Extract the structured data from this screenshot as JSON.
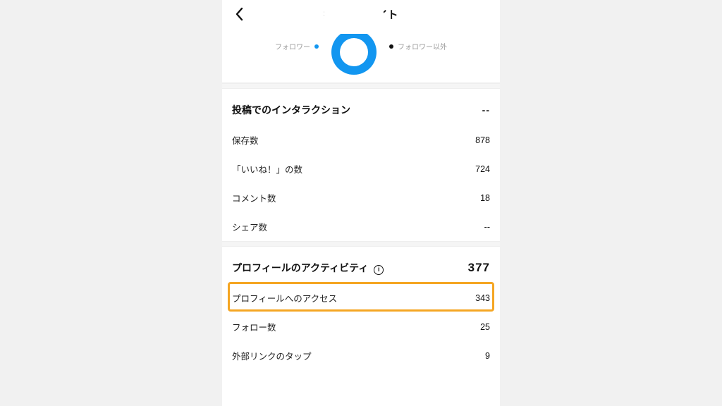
{
  "header": {
    "title": "投稿インサイト"
  },
  "legend": {
    "followers": "フォロワー",
    "non_followers": "フォロワー以外"
  },
  "interactions": {
    "title": "投稿でのインタラクション",
    "total": "--",
    "rows": [
      {
        "label": "保存数",
        "value": "878"
      },
      {
        "label": "「いいね！」の数",
        "value": "724"
      },
      {
        "label": "コメント数",
        "value": "18"
      },
      {
        "label": "シェア数",
        "value": "--"
      }
    ]
  },
  "profile_activity": {
    "title": "プロフィールのアクティビティ",
    "total": "377",
    "rows": [
      {
        "label": "プロフィールへのアクセス",
        "value": "343"
      },
      {
        "label": "フォロー数",
        "value": "25"
      },
      {
        "label": "外部リンクのタップ",
        "value": "9"
      }
    ]
  }
}
